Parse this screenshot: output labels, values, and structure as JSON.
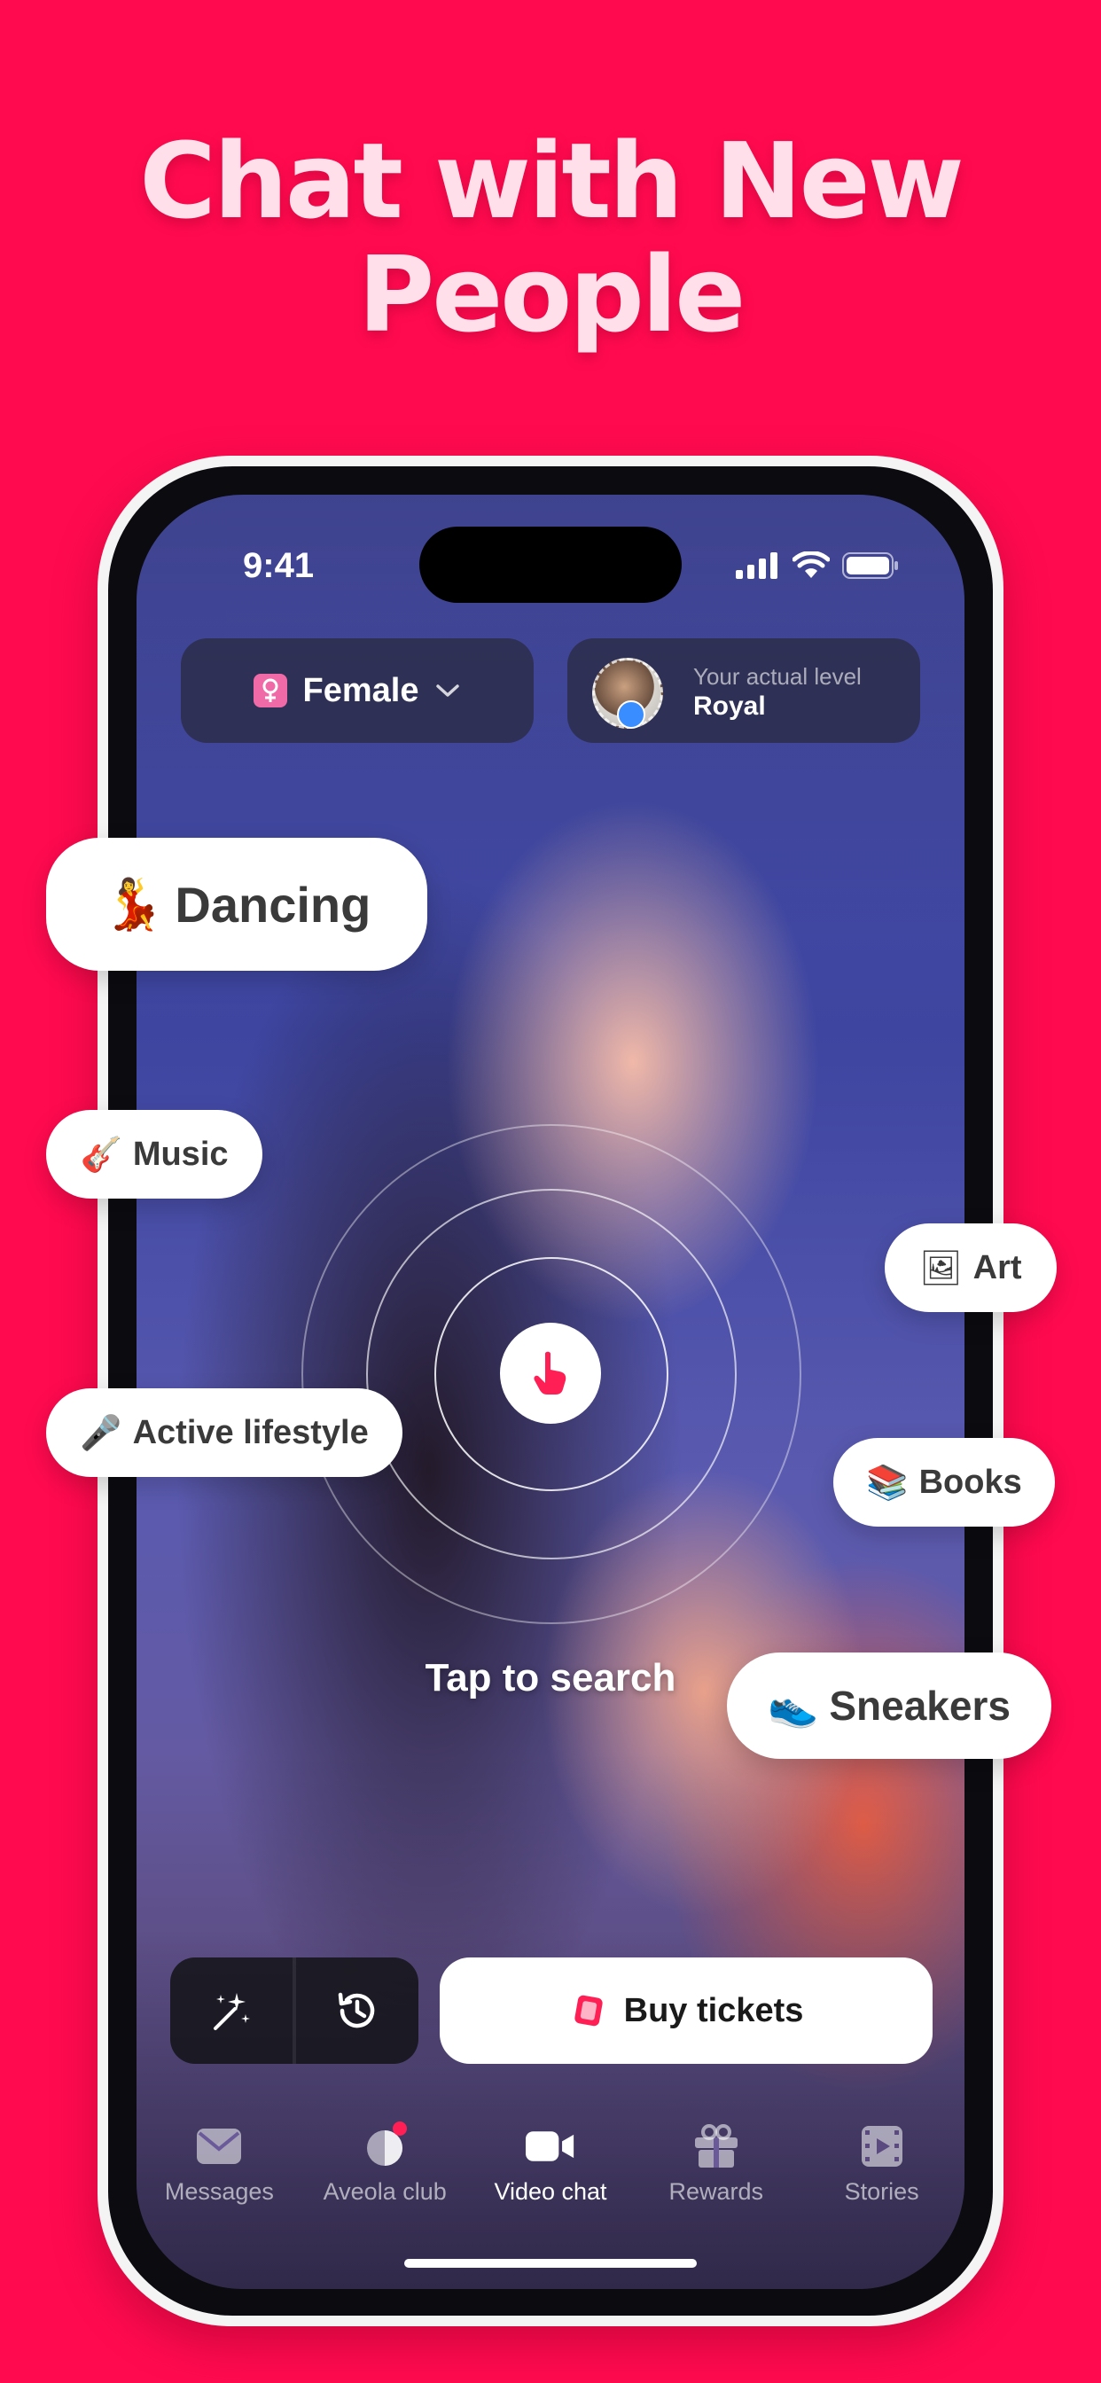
{
  "headline": {
    "line1": "Chat with New",
    "line2": "People"
  },
  "status_bar": {
    "time": "9:41"
  },
  "filters": {
    "gender_label": "Female",
    "level_caption": "Your actual level",
    "level_value": "Royal"
  },
  "tags": {
    "dancing": {
      "emoji": "💃",
      "label": "Dancing"
    },
    "music": {
      "emoji": "🎸",
      "label": "Music"
    },
    "art": {
      "emoji": "🖼",
      "label": "Art"
    },
    "active_lifestyle": {
      "emoji": "🎤",
      "label": "Active lifestyle"
    },
    "books": {
      "emoji": "📚",
      "label": "Books"
    },
    "sneakers": {
      "emoji": "👟",
      "label": "Sneakers"
    }
  },
  "search": {
    "label": "Tap to search"
  },
  "actions": {
    "buy_tickets": "Buy tickets"
  },
  "tabbar": [
    {
      "label": "Messages",
      "icon": "envelope-icon"
    },
    {
      "label": "Aveola club",
      "icon": "club-icon"
    },
    {
      "label": "Video chat",
      "icon": "video-camera-icon"
    },
    {
      "label": "Rewards",
      "icon": "gift-icon"
    },
    {
      "label": "Stories",
      "icon": "film-icon"
    }
  ],
  "colors": {
    "background": "#ff0a4f",
    "accent": "#ff1f55",
    "headline": "#ffe0ea"
  }
}
